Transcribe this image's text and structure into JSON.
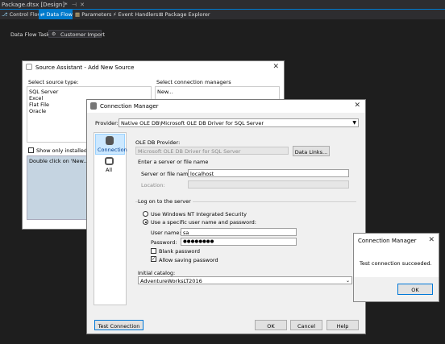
{
  "ide": {
    "doc_tab": "Package.dtsx [Design]*",
    "design_tabs": [
      "Control Flow",
      "Data Flow",
      "Parameters",
      "Event Handlers",
      "Package Explorer"
    ],
    "task_label": "Data Flow Task:",
    "task_value": "Customer Import"
  },
  "source_assistant": {
    "title": "Source Assistant - Add New Source",
    "source_type_label": "Select source type:",
    "source_types": [
      "SQL Server",
      "Excel",
      "Flat File",
      "Oracle"
    ],
    "conn_mgr_label": "Select connection managers",
    "conn_items": [
      "New..."
    ],
    "show_only_label": "Show only installed sou",
    "hint": "Double click on 'New...' or c"
  },
  "connection_manager": {
    "title": "Connection Manager",
    "provider_label": "Provider:",
    "provider_value": "Native OLE DB\\Microsoft OLE DB Driver for SQL Server",
    "nav": [
      "Connection",
      "All"
    ],
    "oledb_provider_label": "OLE DB Provider:",
    "oledb_provider_value": "Microsoft OLE DB Driver for SQL Server",
    "data_links_btn": "Data Links...",
    "server_group_label": "Enter a server or file name",
    "server_label": "Server or file name:",
    "server_value": "localhost",
    "location_label": "Location:",
    "logon_label": "Log on to the server",
    "radio_windows": "Use Windows NT Integrated Security",
    "radio_specific": "Use a specific user name and password:",
    "user_label": "User name:",
    "user_value": "sa",
    "password_label": "Password:",
    "password_value": "●●●●●●●●",
    "blank_pwd": "Blank password",
    "allow_saving": "Allow saving password",
    "allow_saving_checked": "✓",
    "catalog_label": "Initial catalog:",
    "catalog_value": "AdventureWorksLT2016",
    "buttons": {
      "test": "Test Connection",
      "ok": "OK",
      "cancel": "Cancel",
      "help": "Help"
    }
  },
  "message_box": {
    "title": "Connection Manager",
    "message": "Test connection succeeded.",
    "ok": "OK"
  },
  "colors": {
    "accent": "#007acc",
    "ide_bg": "#1e1e1e"
  }
}
